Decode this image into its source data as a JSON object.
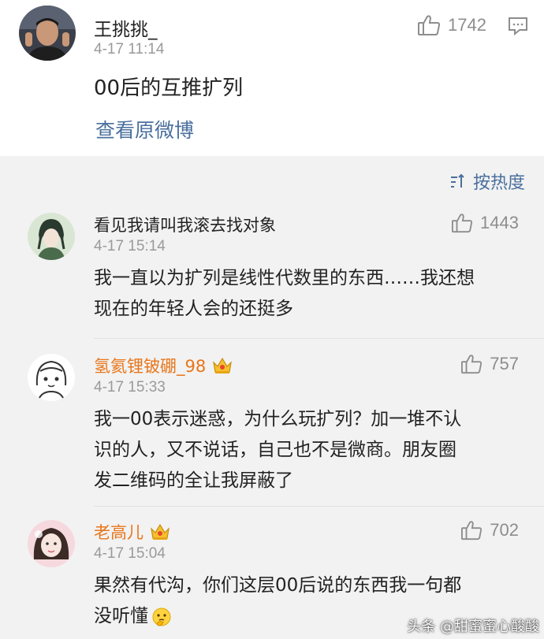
{
  "post": {
    "username": "王挑挑_",
    "time": "4-17 11:14",
    "text": "00后的互推扩列",
    "likes": "1742",
    "view_original": "查看原微博"
  },
  "sort": {
    "label": "按热度"
  },
  "comments": [
    {
      "username": "看见我请叫我滚去找对象",
      "time": "4-17 15:14",
      "likes": "1443",
      "lines": [
        "我一直以为扩列是线性代数里的东西……我还想",
        "现在的年轻人会的还挺多"
      ]
    },
    {
      "username": "氢氦锂铍硼_98",
      "time": "4-17 15:33",
      "likes": "757",
      "lines": [
        "我一00表示迷惑，为什么玩扩列？加一堆不认",
        "识的人，又不说话，自己也不是微商。朋友圈",
        "发二维码的全让我屏蔽了"
      ]
    },
    {
      "username": "老高儿",
      "time": "4-17 15:04",
      "likes": "702",
      "lines": [
        "果然有代沟，你们这层00后说的东西我一句都",
        "没听懂"
      ]
    }
  ],
  "watermark": "头条 @甜蜜蜜心酸酸",
  "colors": {
    "link": "#4a6f9d",
    "vip_name": "#e8761a",
    "muted": "#9a9a9a",
    "background": "#f2f2f2"
  },
  "icons": [
    "thumbs-up-icon",
    "comment-icon",
    "sort-icon",
    "crown-icon",
    "thinking-emoji-icon"
  ]
}
